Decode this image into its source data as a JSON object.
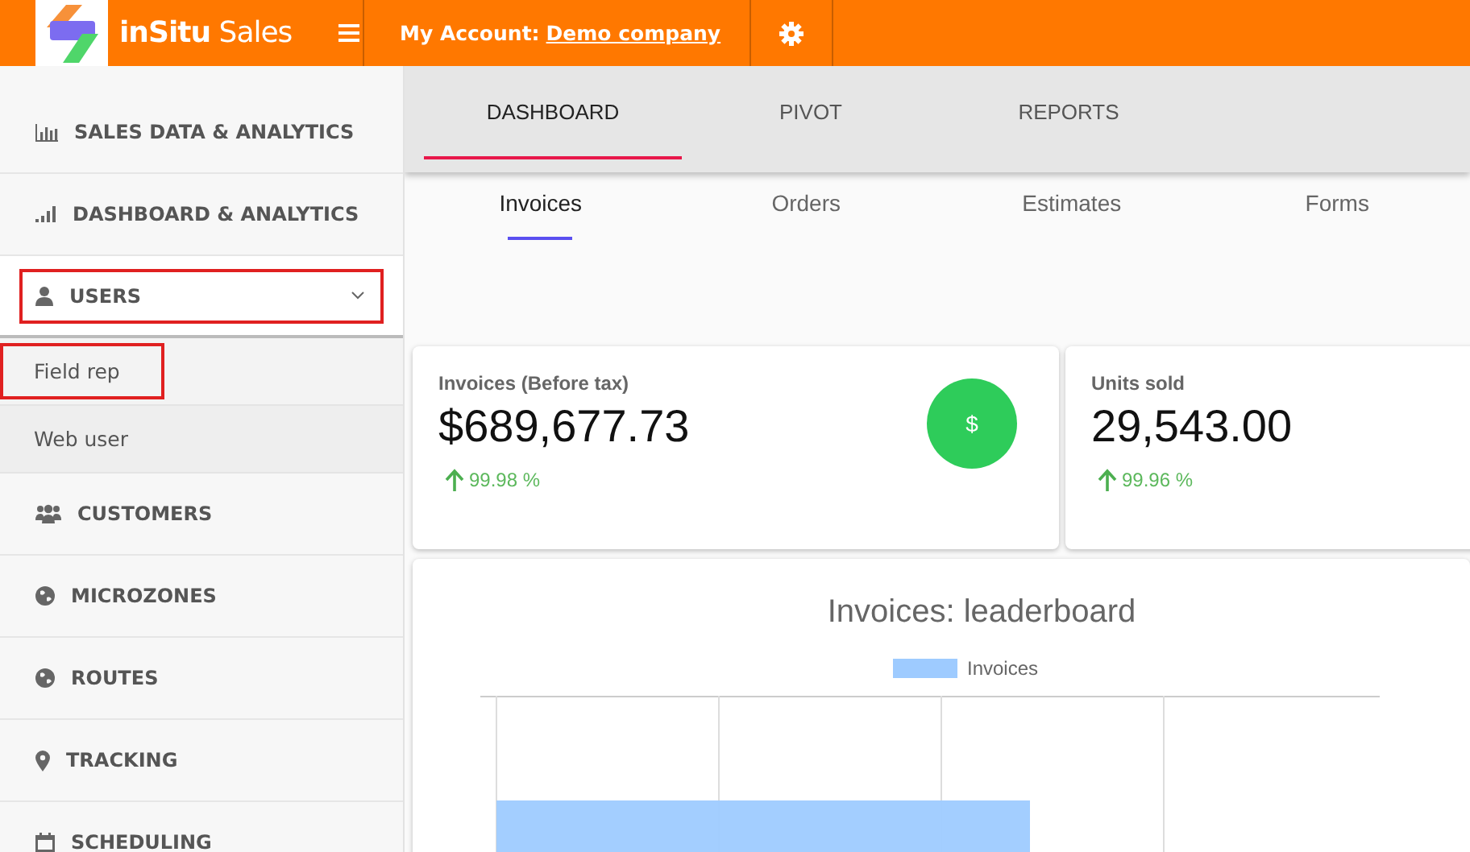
{
  "header": {
    "brand_bold": "inSitu",
    "brand_light": "Sales",
    "account_label": "My Account:",
    "account_name": "Demo company"
  },
  "sidebar": {
    "items": [
      {
        "label": "SALES DATA & ANALYTICS",
        "kind": "bars",
        "expanded": false,
        "highlighted": false
      },
      {
        "label": "DASHBOARD & ANALYTICS",
        "kind": "signal",
        "expanded": false,
        "highlighted": false
      },
      {
        "label": "USERS",
        "kind": "user",
        "expanded": true,
        "highlighted": true,
        "children": [
          {
            "label": "Field rep",
            "selected": true,
            "highlighted": true
          },
          {
            "label": "Web user",
            "selected": false,
            "highlighted": false
          }
        ]
      },
      {
        "label": "CUSTOMERS",
        "kind": "users",
        "expanded": false,
        "highlighted": false
      },
      {
        "label": "MICROZONES",
        "kind": "globe",
        "expanded": false,
        "highlighted": false
      },
      {
        "label": "ROUTES",
        "kind": "globe",
        "expanded": false,
        "highlighted": false
      },
      {
        "label": "TRACKING",
        "kind": "pin",
        "expanded": false,
        "highlighted": false
      },
      {
        "label": "SCHEDULING",
        "kind": "calendar",
        "expanded": false,
        "highlighted": false
      }
    ]
  },
  "tabs": [
    {
      "label": "DASHBOARD",
      "selected": true
    },
    {
      "label": "PIVOT",
      "selected": false
    },
    {
      "label": "REPORTS",
      "selected": false
    }
  ],
  "subtabs": [
    {
      "label": "Invoices",
      "selected": true
    },
    {
      "label": "Orders",
      "selected": false
    },
    {
      "label": "Estimates",
      "selected": false
    },
    {
      "label": "Forms",
      "selected": false
    }
  ],
  "cards": [
    {
      "title": "Invoices (Before tax)",
      "value": "$689,677.73",
      "change": "99.98 %",
      "badge": "$"
    },
    {
      "title": "Units sold",
      "value": "29,543.00",
      "change": "99.96 %"
    }
  ],
  "chart": {
    "title": "Invoices: leaderboard",
    "legend": "Invoices"
  }
}
